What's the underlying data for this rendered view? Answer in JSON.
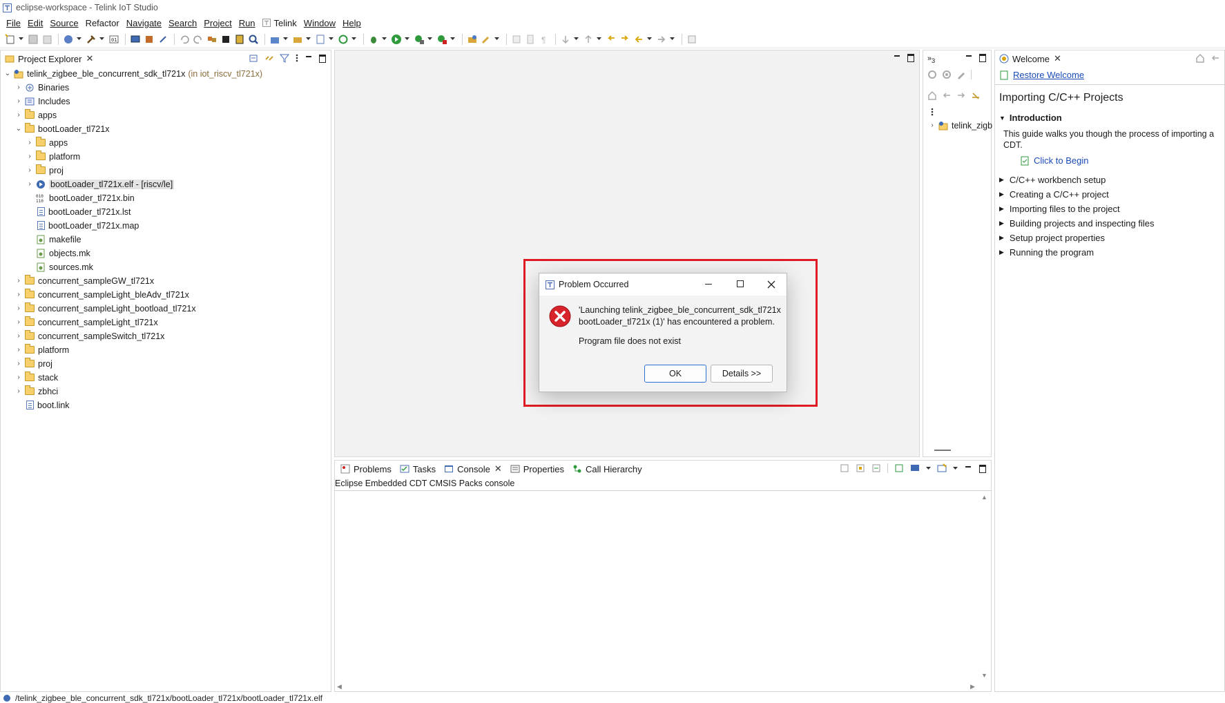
{
  "window": {
    "title": "eclipse-workspace - Telink IoT Studio"
  },
  "menubar": {
    "items": [
      "File",
      "Edit",
      "Source",
      "Refactor",
      "Navigate",
      "Search",
      "Project",
      "Run",
      "Telink",
      "Window",
      "Help"
    ]
  },
  "project_explorer": {
    "tab_label": "Project Explorer",
    "root_label": "telink_zigbee_ble_concurrent_sdk_tl721x",
    "root_suffix": "(in iot_riscv_tl721x)",
    "items": [
      "Binaries",
      "Includes",
      "apps",
      "bootLoader_tl721x",
      "apps",
      "platform",
      "proj",
      "bootLoader_tl721x.elf - [riscv/le]",
      "bootLoader_tl721x.bin",
      "bootLoader_tl721x.lst",
      "bootLoader_tl721x.map",
      "makefile",
      "objects.mk",
      "sources.mk",
      "concurrent_sampleGW_tl721x",
      "concurrent_sampleLight_bleAdv_tl721x",
      "concurrent_sampleLight_bootload_tl721x",
      "concurrent_sampleLight_tl721x",
      "concurrent_sampleSwitch_tl721x",
      "platform",
      "proj",
      "stack",
      "zbhci",
      "boot.link"
    ]
  },
  "outline": {
    "tab_label": "3",
    "tree_item": "telink_zigb"
  },
  "welcome": {
    "tab_label": "Welcome",
    "restore_link": "Restore Welcome",
    "heading": "Importing C/C++ Projects",
    "intro_title": "Introduction",
    "intro_text_1": "This guide walks you though the process of importing a",
    "intro_text_2": "CDT.",
    "click_to_begin": "Click to Begin",
    "sections": [
      "C/C++ workbench setup",
      "Creating a C/C++ project",
      "Importing files to the project",
      "Building projects and inspecting files",
      "Setup project properties",
      "Running the program"
    ]
  },
  "bottom_panel": {
    "tabs": [
      "Problems",
      "Tasks",
      "Console",
      "Properties",
      "Call Hierarchy"
    ],
    "active_tab": "Console",
    "console_title": "Eclipse Embedded CDT CMSIS Packs console"
  },
  "dialog": {
    "title": "Problem Occurred",
    "message_line1": "'Launching telink_zigbee_ble_concurrent_sdk_tl721x",
    "message_line2": "bootLoader_tl721x (1)' has encountered a problem.",
    "detail": "Program file does not exist",
    "ok_label": "OK",
    "details_label": "Details >>",
    "highlight_color": "#e01b24"
  },
  "statusbar": {
    "path": "/telink_zigbee_ble_concurrent_sdk_tl721x/bootLoader_tl721x/bootLoader_tl721x.elf"
  }
}
